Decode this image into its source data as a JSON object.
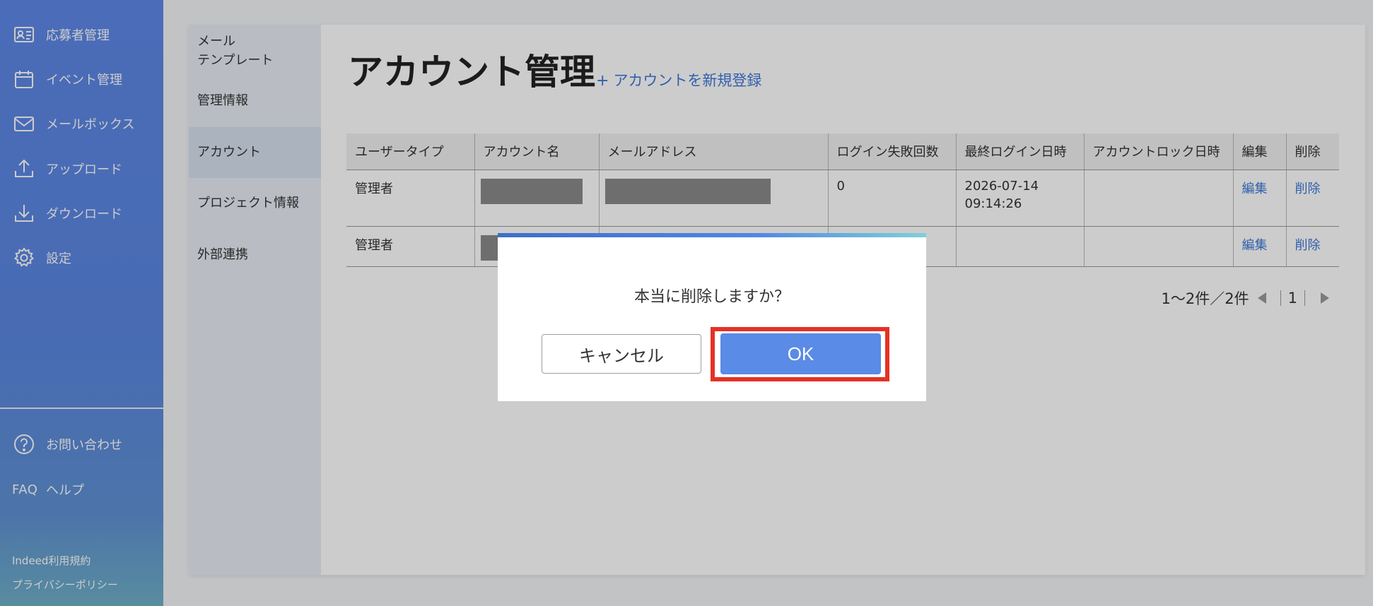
{
  "sidebar": {
    "items": [
      {
        "label": "応募者管理",
        "icon": "applicant-card-icon"
      },
      {
        "label": "イベント管理",
        "icon": "calendar-icon"
      },
      {
        "label": "メールボックス",
        "icon": "mail-icon"
      },
      {
        "label": "アップロード",
        "icon": "upload-icon"
      },
      {
        "label": "ダウンロード",
        "icon": "download-icon"
      },
      {
        "label": "設定",
        "icon": "gear-icon"
      }
    ],
    "contact": {
      "label": "お問い合わせ",
      "icon": "help-question-icon"
    },
    "help": {
      "prefix": "FAQ",
      "label": "ヘルプ"
    },
    "footer": {
      "terms": "Indeed利用規約",
      "privacy": "プライバシーポリシー"
    }
  },
  "subnav": {
    "items": [
      {
        "label": "メール\nテンプレート"
      },
      {
        "label": "管理情報"
      },
      {
        "label": "アカウント",
        "active": true
      },
      {
        "label": "プロジェクト情報"
      },
      {
        "label": "外部連携"
      }
    ]
  },
  "main": {
    "title": "アカウント管理",
    "new_account_plus": "+",
    "new_account_label": "アカウントを新規登録"
  },
  "table": {
    "headers": [
      "ユーザータイプ",
      "アカウント名",
      "メールアドレス",
      "ログイン失敗回数",
      "最終ログイン日時",
      "アカウントロック日時",
      "編集",
      "削除"
    ],
    "rows": [
      {
        "user_type": "管理者",
        "fail_count": "0",
        "last_login_date": "2026-07-14",
        "last_login_time": "09:14:26",
        "lock_date": "",
        "edit": "編集",
        "delete": "削除"
      },
      {
        "user_type": "管理者",
        "fail_count": "",
        "last_login_date": "",
        "last_login_time": "",
        "lock_date": "",
        "edit": "編集",
        "delete": "削除"
      }
    ]
  },
  "pager": {
    "summary": "1〜2件／2件",
    "current_page": "1"
  },
  "dialog": {
    "message": "本当に削除しますか？",
    "cancel_label": "キャンセル",
    "ok_label": "OK"
  },
  "colors": {
    "sidebar": "#5b86e2",
    "accent_link": "#3e78d8",
    "ok_button": "#5a8be6",
    "highlight": "#e53125"
  }
}
